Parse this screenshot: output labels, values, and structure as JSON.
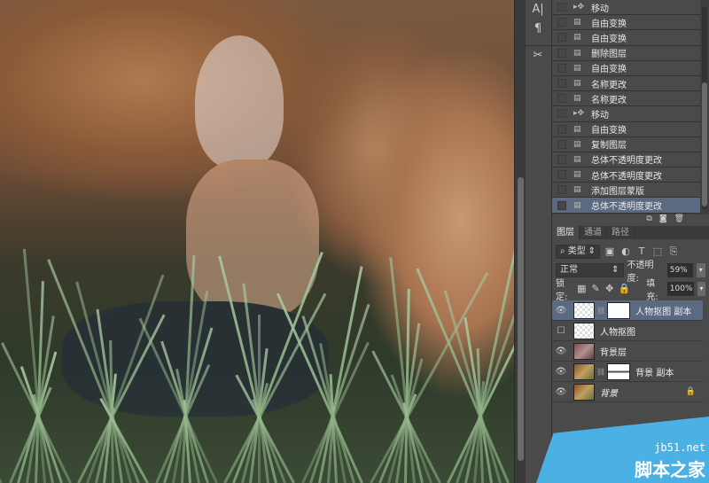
{
  "tools": [
    {
      "icon": "character-panel-icon",
      "glyph": "A|"
    },
    {
      "icon": "paragraph-icon",
      "glyph": "¶"
    },
    {
      "icon": "tool-presets-icon",
      "glyph": "✂"
    }
  ],
  "history": {
    "items": [
      {
        "label": "移动",
        "icon": "move-tool-icon",
        "glyph": "▸✥"
      },
      {
        "label": "自由变换",
        "icon": "history-state-icon",
        "glyph": "▤"
      },
      {
        "label": "自由变换",
        "icon": "history-state-icon",
        "glyph": "▤"
      },
      {
        "label": "删除图层",
        "icon": "history-state-icon",
        "glyph": "▤"
      },
      {
        "label": "自由变换",
        "icon": "history-state-icon",
        "glyph": "▤"
      },
      {
        "label": "名称更改",
        "icon": "history-state-icon",
        "glyph": "▤"
      },
      {
        "label": "名称更改",
        "icon": "history-state-icon",
        "glyph": "▤"
      },
      {
        "label": "移动",
        "icon": "move-tool-icon",
        "glyph": "▸✥"
      },
      {
        "label": "自由变换",
        "icon": "history-state-icon",
        "glyph": "▤"
      },
      {
        "label": "复制图层",
        "icon": "history-state-icon",
        "glyph": "▤"
      },
      {
        "label": "总体不透明度更改",
        "icon": "history-state-icon",
        "glyph": "▤"
      },
      {
        "label": "总体不透明度更改",
        "icon": "history-state-icon",
        "glyph": "▤"
      },
      {
        "label": "添加图层蒙版",
        "icon": "history-state-icon",
        "glyph": "▤"
      },
      {
        "label": "总体不透明度更改",
        "icon": "history-state-icon",
        "glyph": "▤"
      }
    ],
    "footer": "⧉◙🗑"
  },
  "layers": {
    "tabs": [
      "图层",
      "通道",
      "路径"
    ],
    "filter": "⌕ 类型",
    "blend_mode": "正常",
    "opacity_label": "不透明度:",
    "opacity": "59%",
    "lock_label": "锁定:",
    "fill_label": "填充:",
    "fill": "100%",
    "items": [
      {
        "name": "人物抠图 副本",
        "visible": true,
        "selected": true
      },
      {
        "name": "人物抠图",
        "visible": false
      },
      {
        "name": "背景层",
        "visible": true
      },
      {
        "name": "背景 副本",
        "visible": true
      },
      {
        "name": "背景",
        "visible": true,
        "locked": true
      }
    ]
  },
  "watermark": {
    "site": "jb51.net",
    "name": "脚本之家"
  }
}
